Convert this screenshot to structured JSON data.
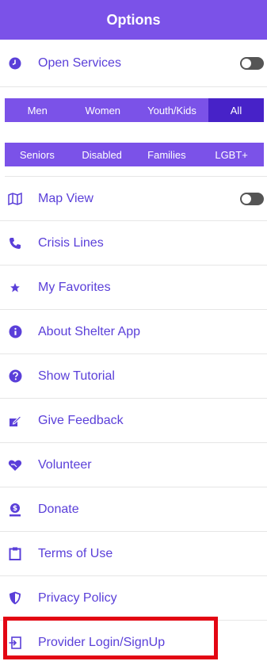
{
  "header": {
    "title": "Options"
  },
  "open_services": {
    "label": "Open Services",
    "enabled": false
  },
  "gender_filters": [
    "Men",
    "Women",
    "Youth/Kids",
    "All"
  ],
  "gender_active": "All",
  "group_filters": [
    "Seniors",
    "Disabled",
    "Families",
    "LGBT+"
  ],
  "map_view": {
    "label": "Map View",
    "enabled": false
  },
  "menu": {
    "crisis_lines": "Crisis Lines",
    "my_favorites": "My Favorites",
    "about": "About Shelter App",
    "show_tutorial": "Show Tutorial",
    "give_feedback": "Give Feedback",
    "volunteer": "Volunteer",
    "donate": "Donate",
    "terms": "Terms of Use",
    "privacy": "Privacy Policy",
    "provider_login": "Provider Login/SignUp"
  },
  "colors": {
    "accent": "#7b52e8",
    "accent_dark": "#4722c8",
    "highlight": "#e30613"
  }
}
